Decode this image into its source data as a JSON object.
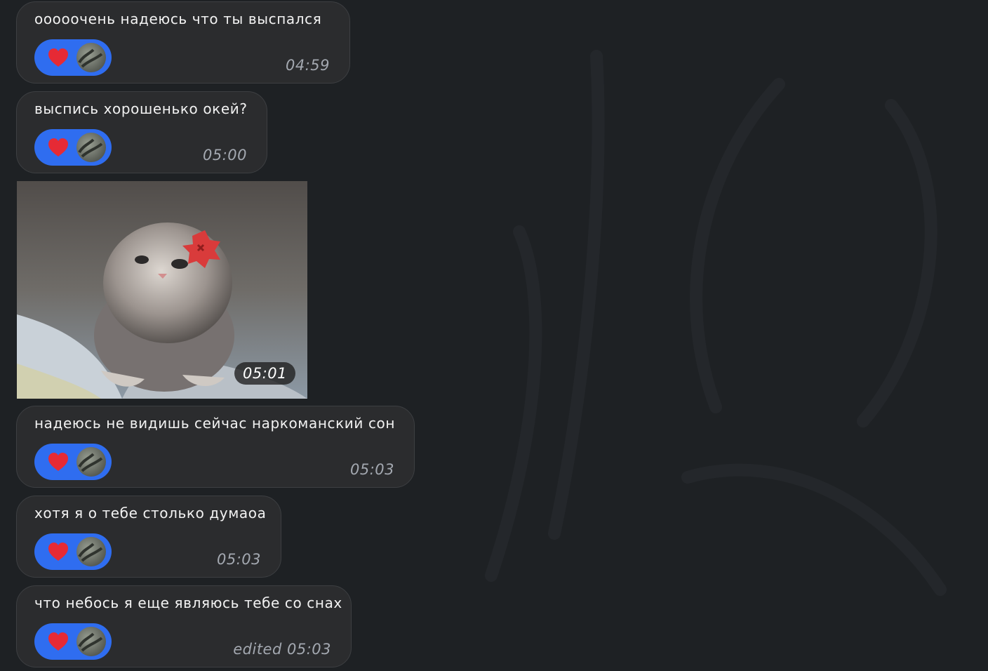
{
  "messages": [
    {
      "text": "ооооочень надеюсь что ты выспался",
      "time": "04:59",
      "reaction": "heart-icon"
    },
    {
      "text": "выспись хорошенько окей?",
      "time": "05:00",
      "reaction": "heart-icon"
    },
    {
      "image": "kitten-photo",
      "time": "05:01"
    },
    {
      "text": "надеюсь не видишь сейчас наркоманский сон",
      "time": "05:03",
      "reaction": "heart-icon"
    },
    {
      "text": "хотя я о тебе столько думаоа",
      "time": "05:03",
      "reaction": "heart-icon"
    },
    {
      "text": "что небось я еще являюсь тебе со снах",
      "time": "edited 05:03",
      "reaction": "heart-icon"
    }
  ],
  "colors": {
    "background": "#1e2124",
    "bubble": "#2b2c2e",
    "reaction": "#2f6df0",
    "time": "#a3a8b0"
  }
}
